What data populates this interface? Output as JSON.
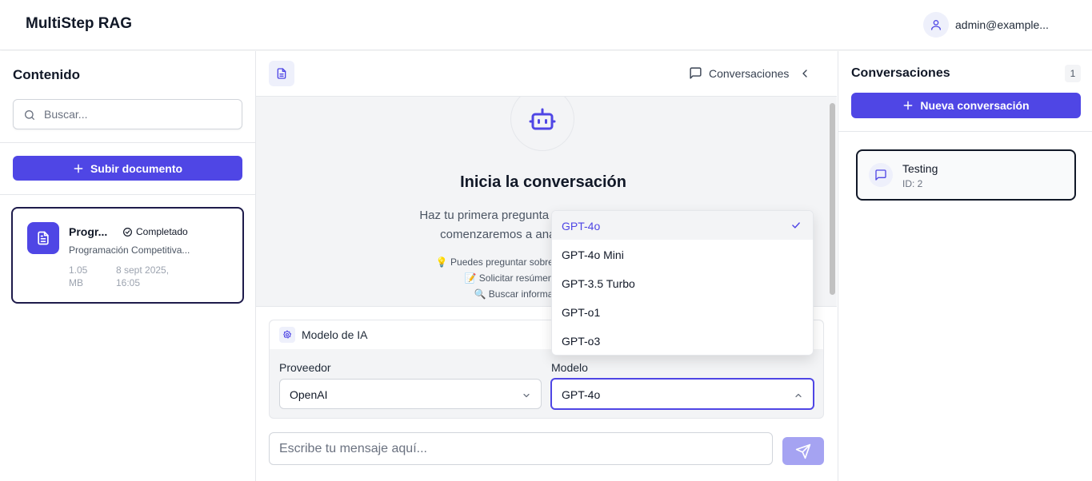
{
  "header": {
    "app_title": "MultiStep RAG",
    "user_email": "admin@example..."
  },
  "sidebar": {
    "title": "Contenido",
    "search_placeholder": "Buscar...",
    "upload_label": "Subir documento",
    "documents": [
      {
        "name": "Progr...",
        "status": "Completado",
        "subtitle": "Programación Competitiva...",
        "size_line1": "1.05",
        "size_line2": "MB",
        "date_line1": "8 sept 2025,",
        "date_line2": "16:05"
      }
    ]
  },
  "center": {
    "conversations_toggle_label": "Conversaciones",
    "empty_title": "Inicia la conversación",
    "empty_desc_line1": "Haz tu primera pregunta sobre el documento y",
    "empty_desc_line2": "comenzaremos a analizar tu contenido",
    "tips": [
      "💡 Puedes preguntar sobre conceptos específicos",
      "📝 Solicitar resúmenes de secciones",
      "🔍 Buscar información detallada"
    ],
    "model_panel": {
      "title": "Modelo de IA",
      "provider_label": "Proveedor",
      "provider_value": "OpenAI",
      "model_label": "Modelo",
      "model_value": "GPT-4o",
      "model_options": [
        "GPT-4o",
        "GPT-4o Mini",
        "GPT-3.5 Turbo",
        "GPT-o1",
        "GPT-o3"
      ],
      "selected_option": "GPT-4o"
    },
    "message_placeholder": "Escribe tu mensaje aquí..."
  },
  "conversations": {
    "title": "Conversaciones",
    "count": "1",
    "new_label": "Nueva conversación",
    "items": [
      {
        "title": "Testing",
        "id": "ID: 2"
      }
    ]
  },
  "colors": {
    "accent": "#4f46e5",
    "send_disabled": "#a5a3f2",
    "muted_bg": "#f3f4f6"
  }
}
